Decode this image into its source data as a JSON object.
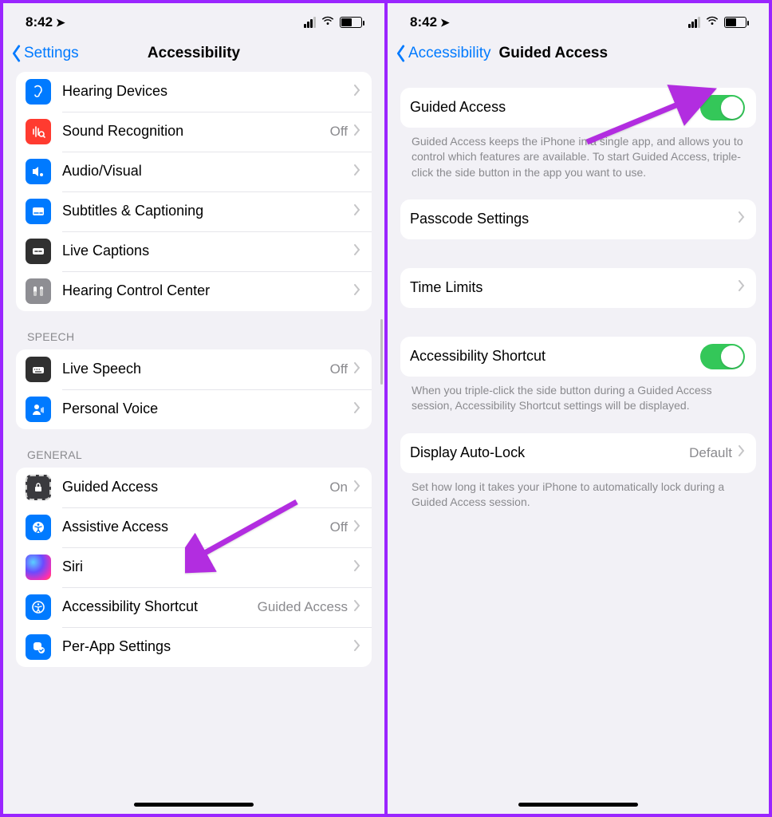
{
  "status": {
    "time": "8:42"
  },
  "left": {
    "nav": {
      "back": "Settings",
      "title": "Accessibility"
    },
    "groupHearing": [
      {
        "label": "Hearing Devices"
      },
      {
        "label": "Sound Recognition",
        "value": "Off"
      },
      {
        "label": "Audio/Visual"
      },
      {
        "label": "Subtitles & Captioning"
      },
      {
        "label": "Live Captions"
      },
      {
        "label": "Hearing Control Center"
      }
    ],
    "headers": {
      "speech": "SPEECH",
      "general": "GENERAL"
    },
    "groupSpeech": [
      {
        "label": "Live Speech",
        "value": "Off"
      },
      {
        "label": "Personal Voice"
      }
    ],
    "groupGeneral": [
      {
        "label": "Guided Access",
        "value": "On"
      },
      {
        "label": "Assistive Access",
        "value": "Off"
      },
      {
        "label": "Siri"
      },
      {
        "label": "Accessibility Shortcut",
        "value": "Guided Access"
      },
      {
        "label": "Per-App Settings"
      }
    ]
  },
  "right": {
    "nav": {
      "back": "Accessibility",
      "title": "Guided Access"
    },
    "rows": {
      "guidedAccess": "Guided Access",
      "passcode": "Passcode Settings",
      "timeLimits": "Time Limits",
      "shortcut": "Accessibility Shortcut",
      "autoLock": "Display Auto-Lock",
      "autoLockValue": "Default"
    },
    "footers": {
      "ga": "Guided Access keeps the iPhone in a single app, and allows you to control which features are available. To start Guided Access, triple-click the side button in the app you want to use.",
      "shortcut": "When you triple-click the side button during a Guided Access session, Accessibility Shortcut settings will be displayed.",
      "autoLock": "Set how long it takes your iPhone to automatically lock during a Guided Access session."
    }
  },
  "annotations": {
    "arrowColor": "#b22de0"
  }
}
